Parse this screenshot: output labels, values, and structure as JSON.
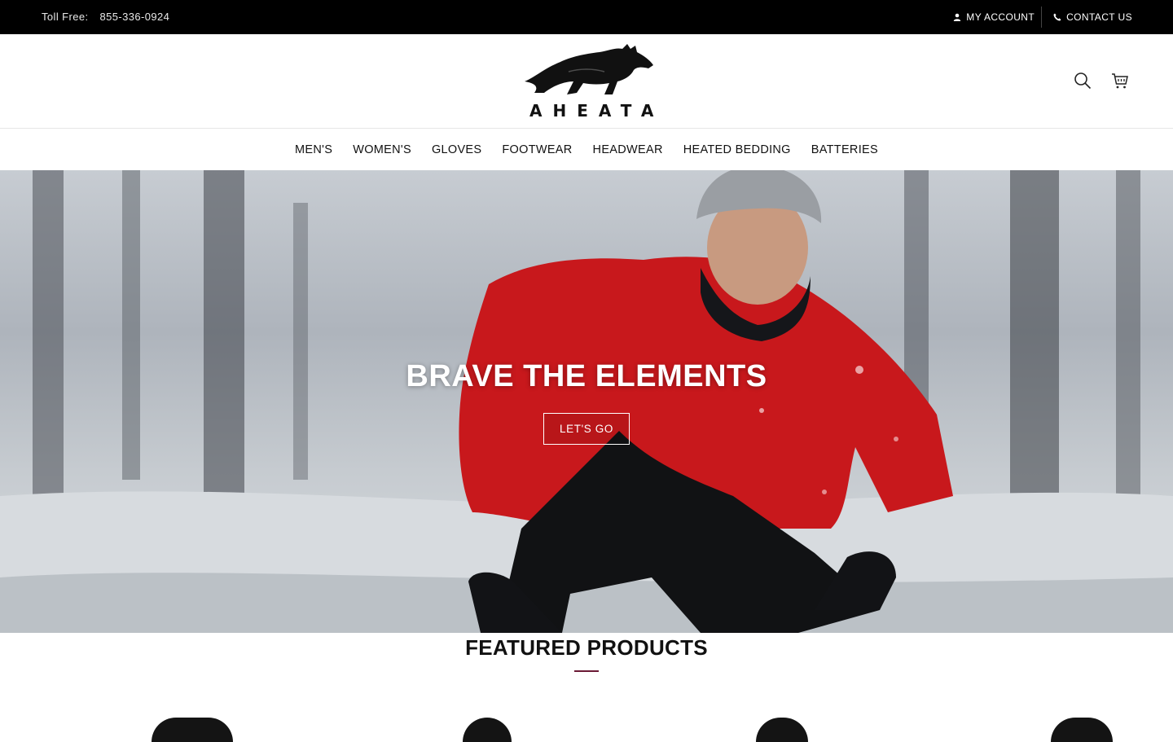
{
  "topbar": {
    "toll_label": "Toll Free:",
    "toll_number": "855-336-0924",
    "account_label": "MY ACCOUNT",
    "account_icon": "user-icon",
    "contact_label": "CONTACT US",
    "contact_icon": "phone-icon"
  },
  "header": {
    "logo_text": "AHEATA",
    "logo_icon": "wolf-logo",
    "search_icon": "search-icon",
    "cart_icon": "cart-icon"
  },
  "nav": {
    "items": [
      "MEN'S",
      "WOMEN'S",
      "GLOVES",
      "FOOTWEAR",
      "HEADWEAR",
      "HEATED BEDDING",
      "BATTERIES"
    ]
  },
  "hero": {
    "title": "BRAVE THE ELEMENTS",
    "button_label": "LET'S GO"
  },
  "featured": {
    "title": "FEATURED PRODUCTS",
    "accent_color": "#6b1a35"
  }
}
